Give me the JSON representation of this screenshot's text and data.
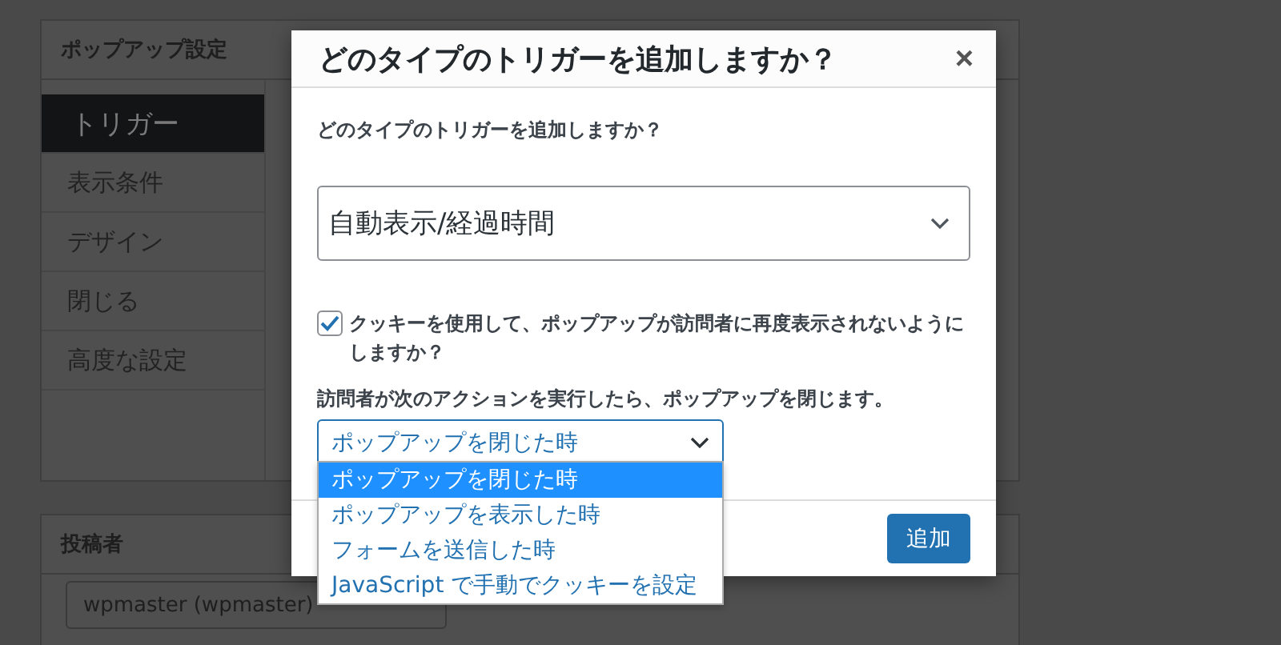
{
  "settings_panel": {
    "title": "ポップアップ設定",
    "tabs": [
      {
        "label": "トリガー",
        "selected": true
      },
      {
        "label": "表示条件",
        "selected": false
      },
      {
        "label": "デザイン",
        "selected": false
      },
      {
        "label": "閉じる",
        "selected": false
      },
      {
        "label": "高度な設定",
        "selected": false
      }
    ]
  },
  "author_panel": {
    "title": "投稿者",
    "select_value": "wpmaster (wpmaster)"
  },
  "dialog": {
    "title": "どのタイプのトリガーを追加しますか？",
    "close": "×",
    "question": "どのタイプのトリガーを追加しますか？",
    "trigger_select": {
      "value": "自動表示/経過時間"
    },
    "cookie_checkbox": {
      "label": "クッキーを使用して、ポップアップが訪問者に再度表示されないようにしますか？",
      "checked": true
    },
    "close_action_label": "訪問者が次のアクションを実行したら、ポップアップを閉じます。",
    "close_action_select": {
      "value": "ポップアップを閉じた時",
      "expanded": true,
      "options": [
        {
          "label": "ポップアップを閉じた時",
          "selected": true
        },
        {
          "label": "ポップアップを表示した時",
          "selected": false
        },
        {
          "label": "フォームを送信した時",
          "selected": false
        },
        {
          "label": "JavaScript で手動でクッキーを設定",
          "selected": false
        }
      ]
    },
    "buttons": [
      {
        "label": "追加"
      }
    ]
  }
}
